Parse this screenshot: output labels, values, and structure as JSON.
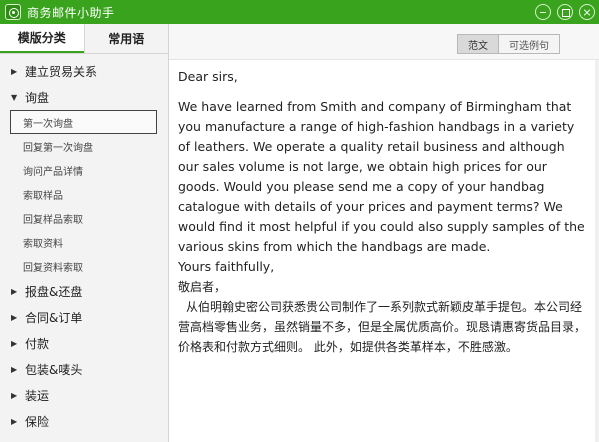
{
  "window": {
    "title": "商务邮件小助手"
  },
  "sidebar": {
    "tabs": [
      {
        "label": "模版分类"
      },
      {
        "label": "常用语"
      }
    ],
    "categories": [
      {
        "label": "建立贸易关系",
        "expanded": false
      },
      {
        "label": "询盘",
        "expanded": true,
        "items": [
          "第一次询盘",
          "回复第一次询盘",
          "询问产品详情",
          "索取样品",
          "回复样品索取",
          "索取资料",
          "回复资料索取"
        ],
        "selected": "第一次询盘"
      },
      {
        "label": "报盘&还盘",
        "expanded": false
      },
      {
        "label": "合同&订单",
        "expanded": false
      },
      {
        "label": "付款",
        "expanded": false
      },
      {
        "label": "包装&唛头",
        "expanded": false
      },
      {
        "label": "装运",
        "expanded": false
      },
      {
        "label": "保险",
        "expanded": false
      }
    ]
  },
  "toolbar": {
    "buttons": [
      "范文",
      "可选例句"
    ],
    "active": "范文"
  },
  "letter": {
    "greeting": "Dear sirs,",
    "body": "We have learned from Smith and company of Birmingham that you manufacture a range of high-fashion handbags in a variety of leathers. We operate a quality retail business and although our sales volume is not large, we obtain high prices for our goods. Would you please send me a copy of your handbag catalogue with details of your prices and payment terms? We would find it most helpful if you could also supply samples of the various skins from which the handbags are made.",
    "closing": "Yours faithfully,",
    "zh_greeting": "敬启者，",
    "zh_body": "从伯明翰史密公司获悉贵公司制作了一系列款式新颖皮革手提包。本公司经营高档零售业务，虽然销量不多，但是全属优质高价。现恳请惠寄货品目录，价格表和付款方式细则。 此外，如提供各类革样本，不胜感激。"
  },
  "colors": {
    "accent": "#3aa31e"
  }
}
